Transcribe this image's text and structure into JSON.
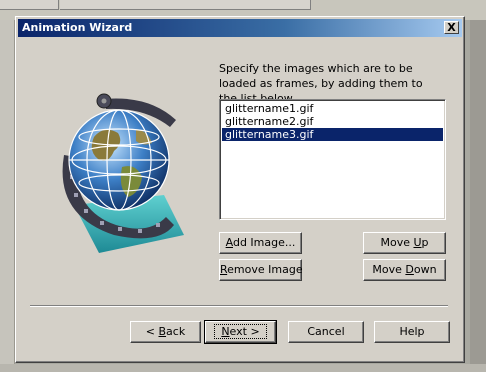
{
  "dialog": {
    "title": "Animation Wizard",
    "close_label": "X"
  },
  "instructions": "Specify the images which are to be loaded as frames, by adding them to the list below.",
  "image_list": {
    "items": [
      "glittername1.gif",
      "glittername2.gif",
      "glittername3.gif"
    ],
    "selected_index": 2
  },
  "buttons": {
    "add_image": {
      "pre": "",
      "mnemonic": "A",
      "post": "dd Image..."
    },
    "remove_image": {
      "pre": "",
      "mnemonic": "R",
      "post": "emove Image"
    },
    "move_up": {
      "pre": "Move ",
      "mnemonic": "U",
      "post": "p"
    },
    "move_down": {
      "pre": "Move ",
      "mnemonic": "D",
      "post": "own"
    },
    "back": {
      "pre": "< ",
      "mnemonic": "B",
      "post": "ack"
    },
    "next": {
      "pre": "",
      "mnemonic": "N",
      "post": "ext >"
    },
    "cancel": "Cancel",
    "help": "Help"
  },
  "illustration": {
    "icon": "globe-film-reel-icon"
  },
  "colors": {
    "title_start": "#0a246a",
    "title_end": "#a6caf0",
    "face": "#d4d0c8",
    "selection": "#0a246a"
  }
}
